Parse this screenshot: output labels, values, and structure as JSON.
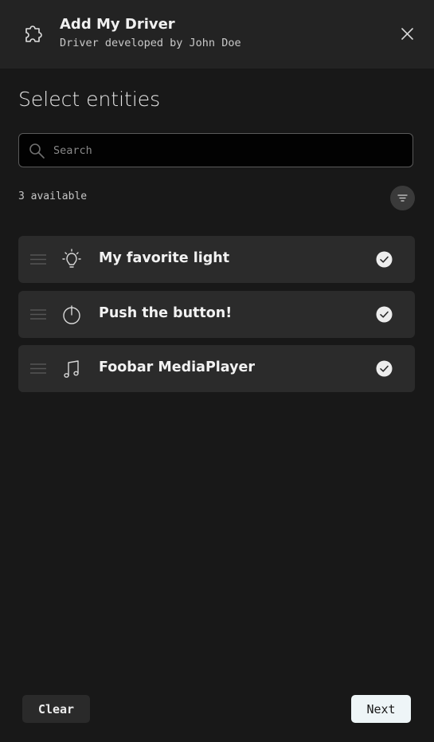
{
  "header": {
    "icon": "puzzle-icon",
    "title": "Add My Driver",
    "subtitle": "Driver developed by John Doe",
    "close_icon": "close-icon"
  },
  "main": {
    "section_title": "Select entities",
    "search": {
      "placeholder": "Search",
      "value": "",
      "icon": "search-icon"
    },
    "count_text": "3 available",
    "filter_icon": "filter-icon",
    "entities": [
      {
        "label": "My favorite light",
        "icon": "light-bulb-icon",
        "selected": true
      },
      {
        "label": "Push the button!",
        "icon": "power-icon",
        "selected": true
      },
      {
        "label": "Foobar MediaPlayer",
        "icon": "music-note-icon",
        "selected": true
      }
    ]
  },
  "footer": {
    "clear_label": "Clear",
    "next_label": "Next"
  },
  "colors": {
    "background": "#181818",
    "header_background": "#232323",
    "item_background": "#2b2b2b",
    "next_button_background": "#eef5f7"
  }
}
